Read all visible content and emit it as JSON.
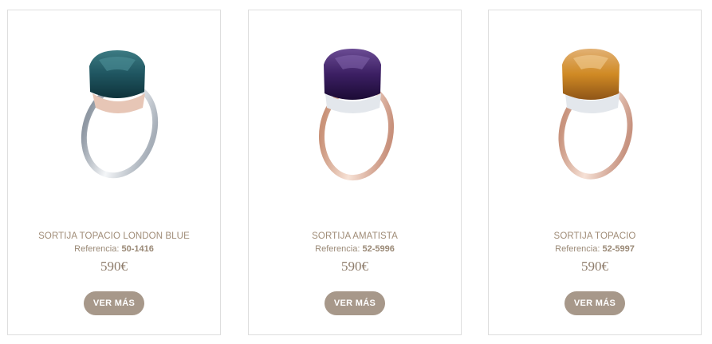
{
  "products": [
    {
      "title": "SORTIJA TOPACIO LONDON BLUE",
      "ref_label": "Referencia:",
      "ref_code": "50-1416",
      "price": "590€",
      "button": "VER MÁS",
      "stone_color": "#1f5560",
      "band_color": "#cfd3d8"
    },
    {
      "title": "SORTIJA AMATISTA",
      "ref_label": "Referencia:",
      "ref_code": "52-5996",
      "price": "590€",
      "button": "VER MÁS",
      "stone_color": "#3c1f63",
      "band_color": "#e7c3ad"
    },
    {
      "title": "SORTIJA TOPACIO",
      "ref_label": "Referencia:",
      "ref_code": "52-5997",
      "price": "590€",
      "button": "VER MÁS",
      "stone_color": "#d08a24",
      "band_color": "#e6c4b0"
    }
  ]
}
